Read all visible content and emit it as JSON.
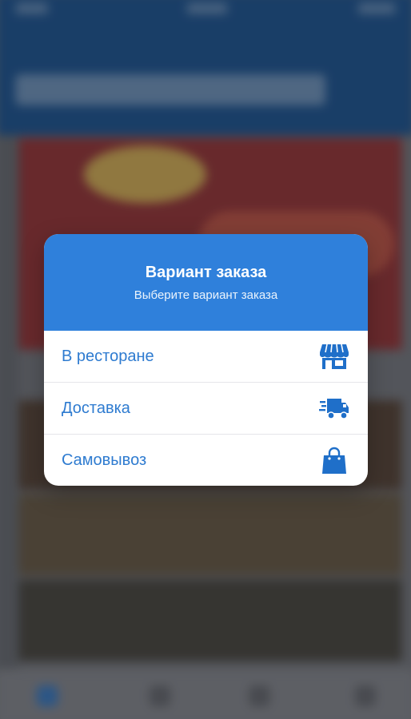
{
  "dialog": {
    "title": "Вариант заказа",
    "subtitle": "Выберите вариант заказа",
    "options": [
      {
        "label": "В ресторане",
        "icon": "store-icon"
      },
      {
        "label": "Доставка",
        "icon": "delivery-truck-icon"
      },
      {
        "label": "Самовывоз",
        "icon": "shopping-bag-icon"
      }
    ]
  },
  "colors": {
    "accent": "#2f80db",
    "option_text": "#2e7bd0",
    "icon": "#1f6fc9",
    "background_header": "#124a86"
  }
}
